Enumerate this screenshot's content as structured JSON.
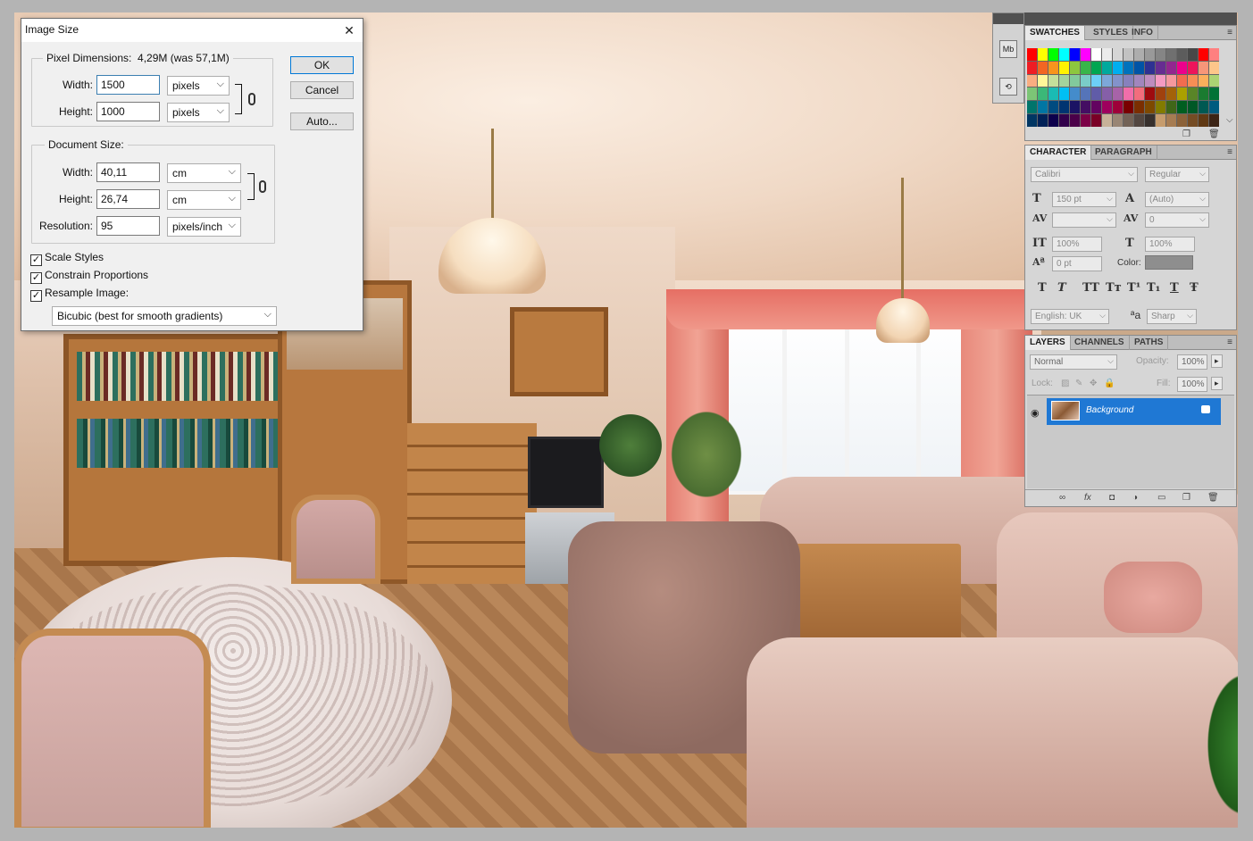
{
  "dialog": {
    "title": "Image Size",
    "pixel_dimensions": {
      "legend": "Pixel Dimensions:",
      "size": "4,29M (was 57,1M)",
      "width_label": "Width:",
      "width_value": "1500",
      "width_unit": "pixels",
      "height_label": "Height:",
      "height_value": "1000",
      "height_unit": "pixels"
    },
    "document_size": {
      "legend": "Document Size:",
      "width_label": "Width:",
      "width_value": "40,11",
      "width_unit": "cm",
      "height_label": "Height:",
      "height_value": "26,74",
      "height_unit": "cm",
      "resolution_label": "Resolution:",
      "resolution_value": "95",
      "resolution_unit": "pixels/inch"
    },
    "options": {
      "scale_styles": "Scale Styles",
      "constrain": "Constrain Proportions",
      "resample": "Resample Image:",
      "scale_styles_checked": true,
      "constrain_checked": true,
      "resample_checked": true
    },
    "resample_method": "Bicubic (best for smooth gradients)",
    "buttons": {
      "ok": "OK",
      "cancel": "Cancel",
      "auto": "Auto..."
    },
    "close_glyph": "✕"
  },
  "swatches_panel": {
    "tabs": [
      "SWATCHES",
      "STYLES",
      "INFO"
    ],
    "colors": [
      "#ff0000",
      "#ffff00",
      "#00ff00",
      "#00ffff",
      "#0000ff",
      "#ff00ff",
      "#ffffff",
      "#ebebeb",
      "#d6d6d6",
      "#c2c2c2",
      "#adadad",
      "#999999",
      "#858585",
      "#707070",
      "#5c5c5c",
      "#474747",
      "#ff0000",
      "#ff8080",
      "#ee1d24",
      "#f26522",
      "#f7941d",
      "#fff200",
      "#8dc63f",
      "#39b54a",
      "#00a651",
      "#00a99d",
      "#00aeef",
      "#0072bc",
      "#0054a6",
      "#2e3192",
      "#662d91",
      "#92278f",
      "#ec008c",
      "#ed145b",
      "#f69679",
      "#fdc68a",
      "#f9ad81",
      "#fff799",
      "#c4df9b",
      "#a3d39c",
      "#82ca9c",
      "#7accc8",
      "#6dcff6",
      "#7da7d9",
      "#8393ca",
      "#8781bd",
      "#a186be",
      "#bd8cbf",
      "#f49ac1",
      "#f5989d",
      "#f26c4f",
      "#f68e55",
      "#fbaf5c",
      "#acd373",
      "#7cc576",
      "#3bb878",
      "#1abbb4",
      "#00bff3",
      "#448ccb",
      "#5574b9",
      "#605ca8",
      "#855fa8",
      "#a763a8",
      "#f06eaa",
      "#f26d7d",
      "#9e0b0f",
      "#a0410d",
      "#a36209",
      "#aba000",
      "#598527",
      "#1a7b30",
      "#007236",
      "#00746b",
      "#0076a3",
      "#004b80",
      "#003471",
      "#1b1464",
      "#440e62",
      "#630460",
      "#9e005d",
      "#9e0039",
      "#790000",
      "#7b2e00",
      "#7d4900",
      "#827b00",
      "#406618",
      "#005e20",
      "#005826",
      "#005952",
      "#005b7f",
      "#003663",
      "#002157",
      "#0d004c",
      "#32004b",
      "#4b0049",
      "#7b0046",
      "#7a0026",
      "#c7b299",
      "#998675",
      "#736357",
      "#534741",
      "#37302d",
      "#c69c6d",
      "#a67c52",
      "#8c6239",
      "#754c24",
      "#603913",
      "#3c2415"
    ]
  },
  "character_panel": {
    "tabs": [
      "CHARACTER",
      "PARAGRAPH"
    ],
    "font_family": "Calibri",
    "font_style": "Regular",
    "font_size": "150 pt",
    "leading": "(Auto)",
    "kerning": "",
    "tracking": "0",
    "vertical_scale": "100%",
    "horizontal_scale": "100%",
    "baseline_shift": "0 pt",
    "color_label": "Color:",
    "language": "English: UK",
    "antialias_icon": "ªa",
    "antialias": "Sharp",
    "style_buttons": [
      "T",
      "T",
      "TT",
      "Tт",
      "T¹",
      "T₁",
      "T",
      "Ŧ"
    ]
  },
  "layers_panel": {
    "tabs": [
      "LAYERS",
      "CHANNELS",
      "PATHS"
    ],
    "blend_mode": "Normal",
    "opacity_label": "Opacity:",
    "opacity": "100%",
    "lock_label": "Lock:",
    "fill_label": "Fill:",
    "fill": "100%",
    "layer_name": "Background",
    "footer_icons": [
      "link-icon",
      "fx-icon",
      "mask-icon",
      "adjustment-icon",
      "group-icon",
      "new-layer-icon",
      "trash-icon"
    ]
  },
  "side_strip": {
    "btn1": "Mb",
    "btn2": "⟲"
  }
}
